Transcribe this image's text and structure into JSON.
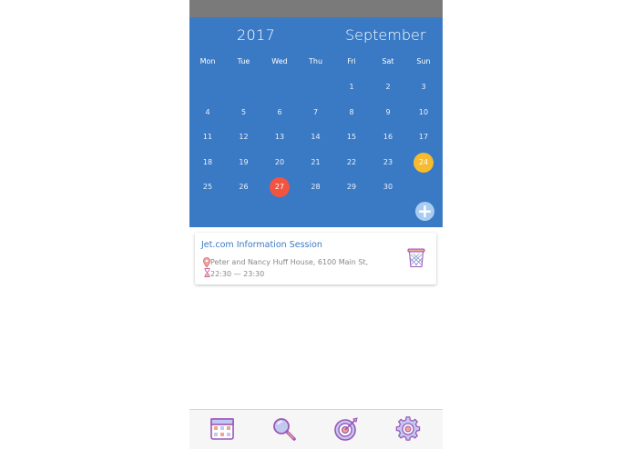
{
  "calendar": {
    "year": "2017",
    "month": "September",
    "weekdays": [
      "Mon",
      "Tue",
      "Wed",
      "Thu",
      "Fri",
      "Sat",
      "Sun"
    ],
    "start_weekday_index": 4,
    "days_in_month": 30,
    "today": 27,
    "selected": 24
  },
  "event": {
    "title": "Jet.com Information Session",
    "location": "Peter and Nancy Huff House, 6100 Main St,",
    "time": "22:30 — 23:30"
  },
  "icons": {
    "add": "plus-icon",
    "location": "map-pin-icon",
    "time": "hourglass-icon",
    "delete": "trash-basket-icon",
    "tabs": [
      "calendar-grid-icon",
      "magnifier-icon",
      "target-icon",
      "gear-icon"
    ]
  },
  "colors": {
    "calendar_bg": "#3a7ac5",
    "today": "#f25440",
    "selected": "#f7bb2f",
    "add_button": "#a9cdf1",
    "event_title": "#3a7ac5"
  }
}
